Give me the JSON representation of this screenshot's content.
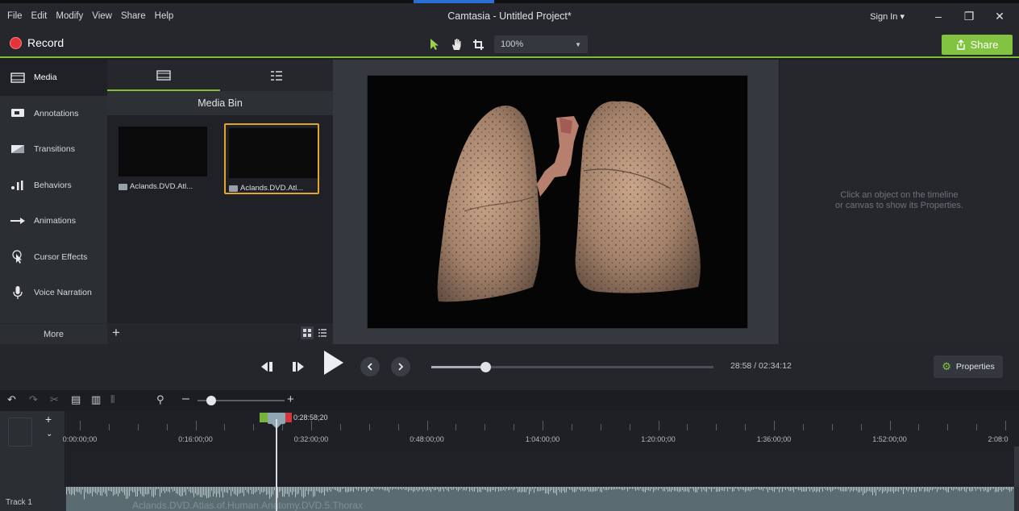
{
  "menu": [
    "File",
    "Edit",
    "Modify",
    "View",
    "Share",
    "Help"
  ],
  "window_title": "Camtasia - Untitled Project*",
  "window_controls": {
    "sign_in": "Sign In ▾",
    "minimize": "–",
    "restore": "❐",
    "close": "✕"
  },
  "toolbar": {
    "record_label": "Record",
    "zoom_value": "100%",
    "share_label": "Share"
  },
  "left_nav": {
    "items": [
      {
        "label": "Media",
        "icon": "film-icon"
      },
      {
        "label": "Annotations",
        "icon": "annotation-icon"
      },
      {
        "label": "Transitions",
        "icon": "transition-icon"
      },
      {
        "label": "Behaviors",
        "icon": "behavior-icon"
      },
      {
        "label": "Animations",
        "icon": "animation-arrow-icon"
      },
      {
        "label": "Cursor Effects",
        "icon": "cursor-icon"
      },
      {
        "label": "Voice Narration",
        "icon": "microphone-icon"
      }
    ],
    "more": "More"
  },
  "media_bin": {
    "header": "Media Bin",
    "items": [
      {
        "label": "Aclands.DVD.Atl..."
      },
      {
        "label": "Aclands.DVD.Atl..."
      }
    ]
  },
  "properties": {
    "hint_line1": "Click an object on the timeline",
    "hint_line2": "or canvas to show its Properties.",
    "button": "Properties"
  },
  "playback": {
    "time": "28:58  /  02:34:12",
    "progress": 0.19
  },
  "timeline": {
    "zoom_level": 0.16,
    "playhead_time": "0:28:58;20",
    "ruler_labels": [
      "0:00:00;00",
      "0:16:00;00",
      "0:32:00;00",
      "0:48:00;00",
      "1:04:00;00",
      "1:20:00;00",
      "1:36:00;00",
      "1:52:00;00",
      "2:08:0"
    ],
    "track_name": "Track 1",
    "clip_label": "Aclands.DVD.Atlas.of.Human.Anatomy.DVD.5.Thorax"
  },
  "colors": {
    "accent_green": "#82c341",
    "record_red": "#e8323a",
    "selection_orange": "#e0a52a"
  }
}
